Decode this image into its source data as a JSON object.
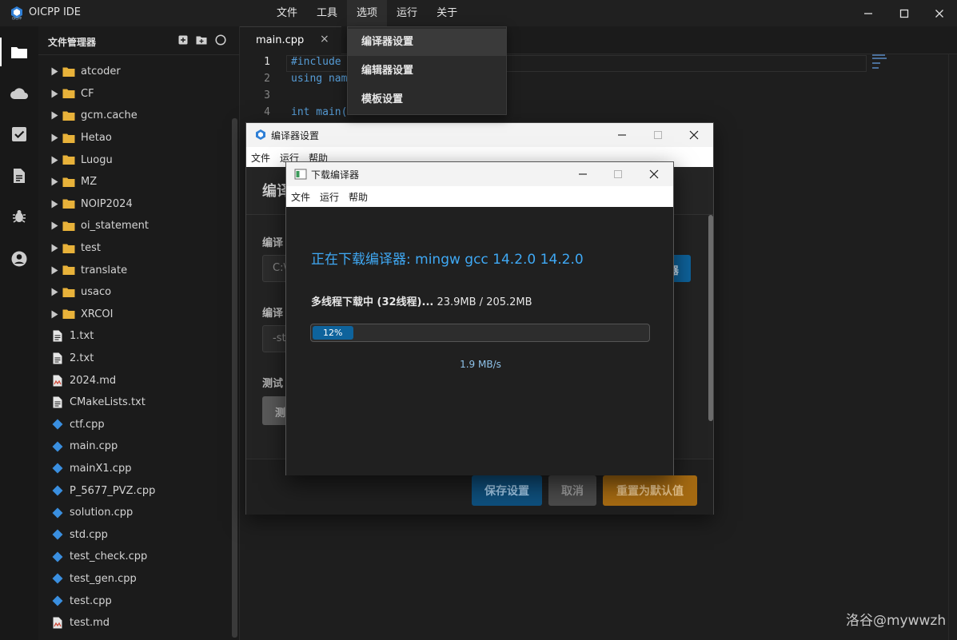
{
  "app": {
    "title": "OICPP IDE"
  },
  "menubar": {
    "items": [
      "文件",
      "工具",
      "选项",
      "运行",
      "关于"
    ]
  },
  "options_menu": {
    "items": [
      "编译器设置",
      "编辑器设置",
      "模板设置"
    ]
  },
  "sidebar": {
    "title": "文件管理器",
    "folders": [
      "atcoder",
      "CF",
      "gcm.cache",
      "Hetao",
      "Luogu",
      "MZ",
      "NOIP2024",
      "oi_statement",
      "test",
      "translate",
      "usaco",
      "XRCOI"
    ],
    "files": [
      {
        "name": "1.txt",
        "type": "text"
      },
      {
        "name": "2.txt",
        "type": "text"
      },
      {
        "name": "2024.md",
        "type": "markdown"
      },
      {
        "name": "CMakeLists.txt",
        "type": "text"
      },
      {
        "name": "ctf.cpp",
        "type": "cpp"
      },
      {
        "name": "main.cpp",
        "type": "cpp"
      },
      {
        "name": "mainX1.cpp",
        "type": "cpp"
      },
      {
        "name": "P_5677_PVZ.cpp",
        "type": "cpp"
      },
      {
        "name": "solution.cpp",
        "type": "cpp"
      },
      {
        "name": "std.cpp",
        "type": "cpp"
      },
      {
        "name": "test_check.cpp",
        "type": "cpp"
      },
      {
        "name": "test_gen.cpp",
        "type": "cpp"
      },
      {
        "name": "test.cpp",
        "type": "cpp"
      },
      {
        "name": "test.md",
        "type": "markdown"
      }
    ]
  },
  "editor": {
    "tab": "main.cpp",
    "tab_close": "×",
    "lines": [
      {
        "no": "1",
        "code": "#include",
        "cls": "kw-dir"
      },
      {
        "no": "2",
        "code": "using nam",
        "cls": "kw"
      },
      {
        "no": "3",
        "code": "",
        "cls": ""
      },
      {
        "no": "4",
        "code": "int main(",
        "cls": "kw"
      }
    ]
  },
  "compiler_window": {
    "title": "编译器设置",
    "menus": [
      "文件",
      "运行",
      "帮助"
    ],
    "heading": "编译",
    "label1": "编译",
    "input1": "C:\\",
    "browse": "器",
    "label2": "编译",
    "input2": "-st",
    "label3": "测试",
    "test_btn": "测",
    "save": "保存设置",
    "cancel": "取消",
    "reset": "重置为默认值"
  },
  "download_window": {
    "title": "下载编译器",
    "menus": [
      "文件",
      "运行",
      "帮助"
    ],
    "heading": "正在下载编译器: mingw gcc 14.2.0 14.2.0",
    "status_prefix": "多线程下载中 (32线程)...",
    "status_size": "23.9MB / 205.2MB",
    "progress": 12,
    "progress_label": "12%",
    "speed": "1.9 MB/s"
  },
  "watermark": "洛谷@mywwzh",
  "colors": {
    "accent": "#0e639c",
    "folder": "#e8b23a",
    "cpp": "#3a8fe0",
    "link": "#3fa9f5",
    "warning": "#a56a12"
  }
}
